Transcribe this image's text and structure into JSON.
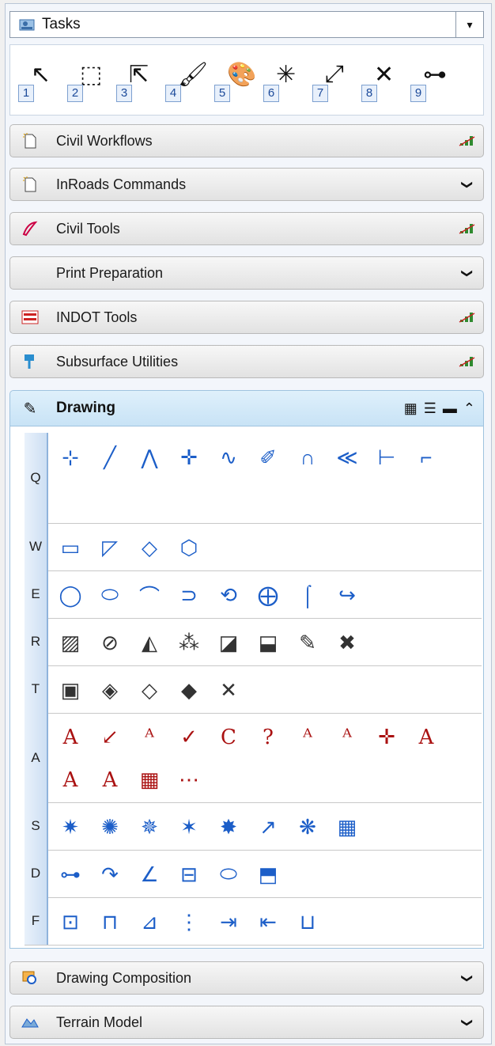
{
  "tasks": {
    "label": "Tasks",
    "arrow": "▾"
  },
  "quickbar": {
    "tools": [
      {
        "num": "1",
        "icon": "pointer-icon",
        "glyph": "↖"
      },
      {
        "num": "2",
        "icon": "selection-icon",
        "glyph": "⬚"
      },
      {
        "num": "3",
        "icon": "move-icon",
        "glyph": "⇱"
      },
      {
        "num": "4",
        "icon": "paint-brush-icon",
        "glyph": "🖌"
      },
      {
        "num": "5",
        "icon": "palette-icon",
        "glyph": "🎨"
      },
      {
        "num": "6",
        "icon": "explode-icon",
        "glyph": "✳"
      },
      {
        "num": "7",
        "icon": "scale-icon",
        "glyph": "⤢"
      },
      {
        "num": "8",
        "icon": "delete-icon",
        "glyph": "✕"
      },
      {
        "num": "9",
        "icon": "measure-icon",
        "glyph": "⊶"
      }
    ]
  },
  "groups": [
    {
      "label": "Civil Workflows",
      "icon": "new-file-icon",
      "right": "signal-icon"
    },
    {
      "label": "InRoads Commands",
      "icon": "new-file-icon",
      "right": "chevron-down-icon"
    },
    {
      "label": "Civil Tools",
      "icon": "civil-tools-icon",
      "right": "signal-icon"
    },
    {
      "label": "Print Preparation",
      "icon": "",
      "right": "chevron-down-icon"
    },
    {
      "label": "INDOT Tools",
      "icon": "indot-icon",
      "right": "signal-icon"
    },
    {
      "label": "Subsurface Utilities",
      "icon": "subsurface-icon",
      "right": "signal-icon"
    }
  ],
  "drawing": {
    "label": "Drawing",
    "rows": [
      {
        "key": "Q",
        "count": 10
      },
      {
        "key": "W",
        "count": 4
      },
      {
        "key": "E",
        "count": 8
      },
      {
        "key": "R",
        "count": 8
      },
      {
        "key": "T",
        "count": 5
      },
      {
        "key": "A",
        "count": 14
      },
      {
        "key": "S",
        "count": 8
      },
      {
        "key": "D",
        "count": 6
      },
      {
        "key": "F",
        "count": 7
      }
    ]
  },
  "footer_groups": [
    {
      "label": "Drawing Composition",
      "icon": "drawing-composition-icon",
      "right": "chevron-down-icon"
    },
    {
      "label": "Terrain Model",
      "icon": "terrain-model-icon",
      "right": "chevron-down-icon"
    }
  ],
  "colors": {
    "accent": "#1c5ec8",
    "signal": "#2f8a2f"
  }
}
